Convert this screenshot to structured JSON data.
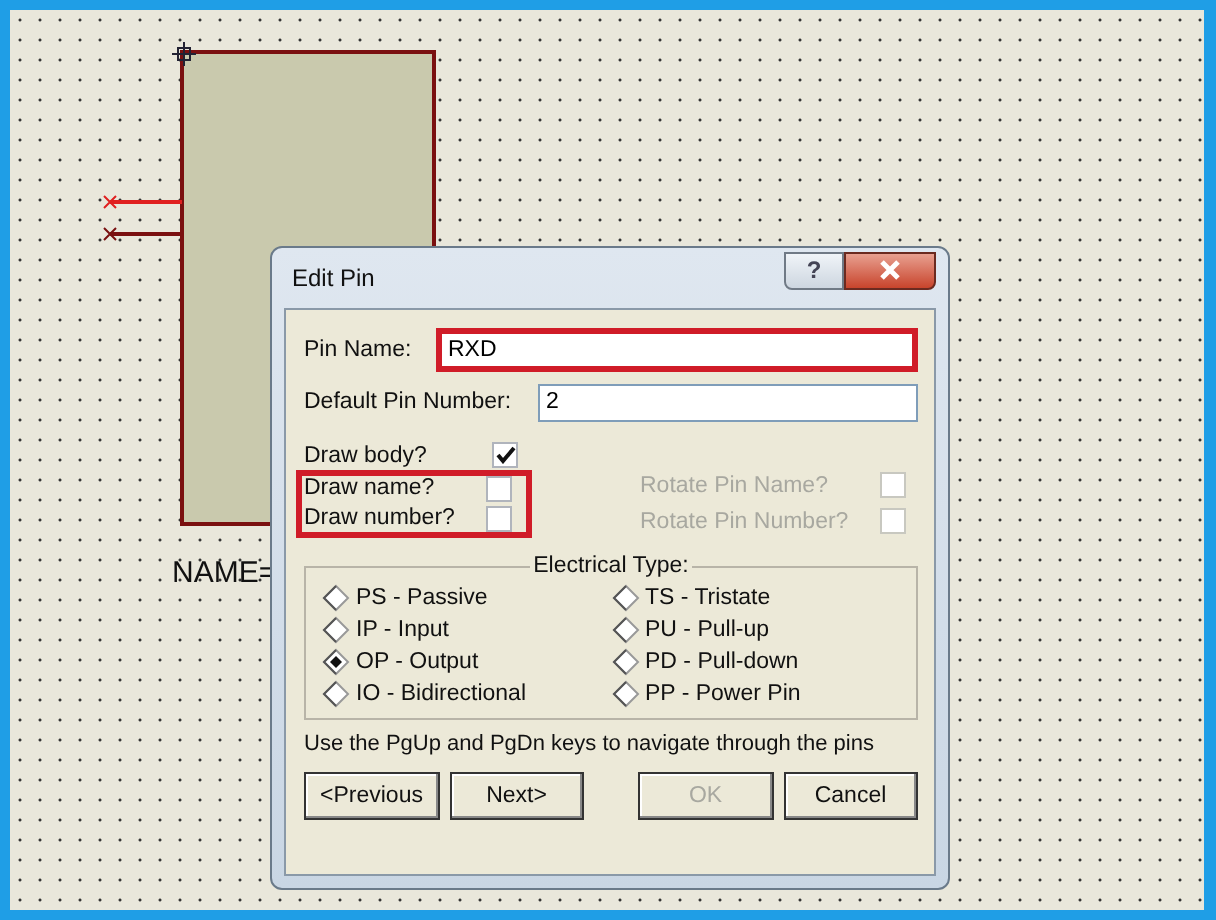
{
  "canvas": {
    "part_label": "NAME=",
    "pins": [
      {
        "color": "#e02020"
      },
      {
        "color": "#7a1010"
      }
    ]
  },
  "dialog": {
    "title": "Edit Pin",
    "help": "?",
    "pin_name": {
      "label": "Pin Name:",
      "value": "RXD",
      "highlighted": true
    },
    "default_pin_number": {
      "label": "Default Pin Number:",
      "value": "2"
    },
    "checkboxes": [
      {
        "label": "Draw body?",
        "checked": true,
        "disabled": false
      },
      {
        "label": "Draw name?",
        "checked": false,
        "disabled": false
      },
      {
        "label": "Draw number?",
        "checked": false,
        "disabled": false
      },
      {
        "label": "Rotate Pin Name?",
        "checked": false,
        "disabled": true
      },
      {
        "label": "Rotate Pin Number?",
        "checked": false,
        "disabled": true
      }
    ],
    "draw_options_highlighted": true,
    "electrical_type": {
      "title": "Electrical Type:",
      "options": [
        {
          "label": "PS - Passive",
          "selected": false
        },
        {
          "label": "IP - Input",
          "selected": false
        },
        {
          "label": "OP - Output",
          "selected": true
        },
        {
          "label": "IO - Bidirectional",
          "selected": false
        },
        {
          "label": "TS - Tristate",
          "selected": false
        },
        {
          "label": "PU - Pull-up",
          "selected": false
        },
        {
          "label": "PD - Pull-down",
          "selected": false
        },
        {
          "label": "PP - Power Pin",
          "selected": false
        }
      ]
    },
    "hint": "Use the PgUp and PgDn keys to navigate through the pins",
    "buttons": [
      {
        "label": "<Previous",
        "disabled": false
      },
      {
        "label": "Next>",
        "disabled": false
      },
      {
        "label": "OK",
        "disabled": true
      },
      {
        "label": "Cancel",
        "disabled": false
      }
    ]
  }
}
